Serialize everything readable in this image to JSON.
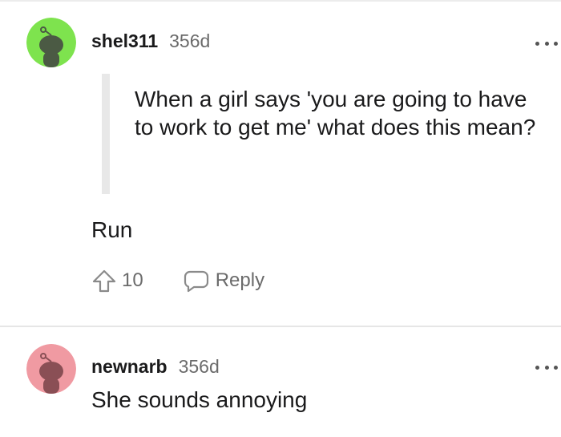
{
  "comments": [
    {
      "username": "shel311",
      "age": "356d",
      "avatar_color": "#7ee34e",
      "quote": "When a girl says 'you are going to have to work to get me' what does this mean?",
      "body": "Run",
      "upvotes": "10",
      "reply_label": "Reply"
    },
    {
      "username": "newnarb",
      "age": "356d",
      "avatar_color": "#f09aa2",
      "body": "She sounds annoying"
    }
  ],
  "icons": {
    "more": "more-options-icon",
    "upvote": "upvote-arrow-icon",
    "reply": "speech-bubble-icon",
    "avatar": "reddit-snoo-avatar"
  },
  "colors": {
    "text_primary": "#1a1a1b",
    "text_secondary": "#6b6b6b",
    "quote_bar": "#e8e8e8",
    "divider": "#e6e6e6"
  }
}
